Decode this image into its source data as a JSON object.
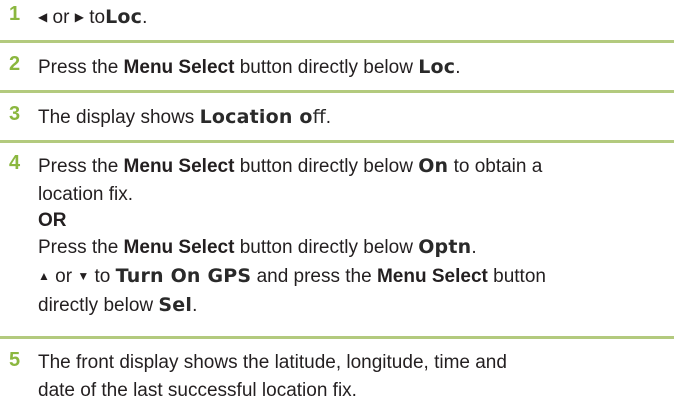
{
  "steps": [
    {
      "number": "1",
      "or": "or",
      "to": "to",
      "target": "Loc",
      "end": "."
    },
    {
      "number": "2",
      "pre": "Press the",
      "button": "Menu Select",
      "post": "button directly below",
      "target": "Loc",
      "end": "."
    },
    {
      "number": "3",
      "pre": "The display shows",
      "target_bold": "Location o",
      "target_tail": "ff",
      "end": "."
    },
    {
      "number": "4",
      "line1_pre": "Press the",
      "line1_button": "Menu Select",
      "line1_post": "button directly below",
      "line1_target": "On",
      "line1_tail": "to obtain a",
      "line2": "location fix.",
      "or_label": "OR",
      "line4_pre": "Press the",
      "line4_button": "Menu Select",
      "line4_post": "button directly below",
      "line4_target": "Optn",
      "line4_end": ".",
      "line5_or": "or",
      "line5_to": "to",
      "line5_target": "Turn On GPS",
      "line5_mid": "and press the",
      "line5_button": "Menu Select",
      "line5_post": "button",
      "line6_pre": "directly below",
      "line6_target": "Sel",
      "line6_end": "."
    },
    {
      "number": "5",
      "line1": "The front display shows the latitude, longitude, time and",
      "line2": "date of the last successful location fix."
    }
  ],
  "colors": {
    "step_number": "#8bb73f",
    "separator": "#b3ca7e",
    "text": "#231f20"
  }
}
